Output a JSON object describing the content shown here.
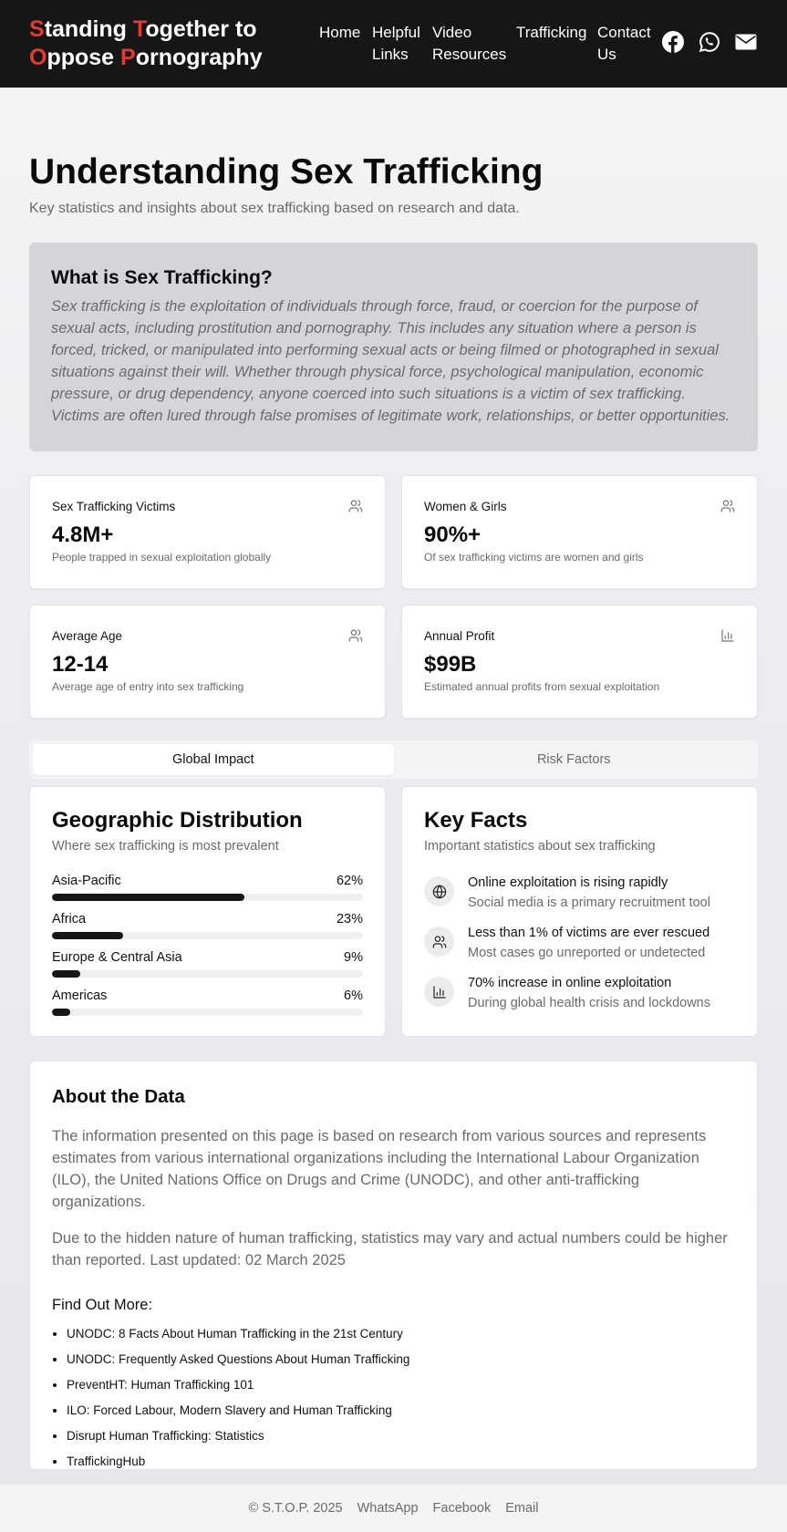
{
  "header": {
    "logo": {
      "line1": [
        {
          "cap": "S",
          "rest": "tanding "
        },
        {
          "cap": "T",
          "rest": "ogether to"
        }
      ],
      "line2": [
        {
          "cap": "O",
          "rest": "ppose "
        },
        {
          "cap": "P",
          "rest": "ornography"
        }
      ]
    },
    "nav": [
      {
        "line1": "Home",
        "line2": ""
      },
      {
        "line1": "Helpful",
        "line2": "Links"
      },
      {
        "line1": "Video",
        "line2": "Resources"
      },
      {
        "line1": "Trafficking",
        "line2": ""
      },
      {
        "line1": "Contact",
        "line2": "Us"
      }
    ],
    "social_icons": [
      "facebook-icon",
      "whatsapp-icon",
      "email-icon"
    ],
    "accent_color": "#e53935"
  },
  "page": {
    "title": "Understanding Sex Trafficking",
    "subtitle": "Key statistics and insights about sex trafficking based on research and data."
  },
  "definition": {
    "heading": "What is Sex Trafficking?",
    "body": "Sex trafficking is the exploitation of individuals through force, fraud, or coercion for the purpose of sexual acts, including prostitution and pornography. This includes any situation where a person is forced, tricked, or manipulated into performing sexual acts or being filmed or photographed in sexual situations against their will. Whether through physical force, psychological manipulation, economic pressure, or drug dependency, anyone coerced into such situations is a victim of sex trafficking. Victims are often lured through false promises of legitimate work, relationships, or better opportunities."
  },
  "stats": [
    {
      "label": "Sex Trafficking Victims",
      "value": "4.8M+",
      "desc": "People trapped in sexual exploitation globally",
      "icon": "users-icon"
    },
    {
      "label": "Women & Girls",
      "value": "90%+",
      "desc": "Of sex trafficking victims are women and girls",
      "icon": "users-icon"
    },
    {
      "label": "Average Age",
      "value": "12-14",
      "desc": "Average age of entry into sex trafficking",
      "icon": "users-icon"
    },
    {
      "label": "Annual Profit",
      "value": "$99B",
      "desc": "Estimated annual profits from sexual exploitation",
      "icon": "bar-chart-icon"
    }
  ],
  "tabs": [
    {
      "label": "Global Impact",
      "active": true
    },
    {
      "label": "Risk Factors",
      "active": false
    }
  ],
  "geo": {
    "title": "Geographic Distribution",
    "subtitle": "Where sex trafficking is most prevalent",
    "rows": [
      {
        "region": "Asia-Pacific",
        "pct_label": "62%",
        "pct": 62
      },
      {
        "region": "Africa",
        "pct_label": "23%",
        "pct": 23
      },
      {
        "region": "Europe & Central Asia",
        "pct_label": "9%",
        "pct": 9
      },
      {
        "region": "Americas",
        "pct_label": "6%",
        "pct": 6
      }
    ]
  },
  "facts": {
    "title": "Key Facts",
    "subtitle": "Important statistics about sex trafficking",
    "items": [
      {
        "title": "Online exploitation is rising rapidly",
        "sub": "Social media is a primary recruitment tool",
        "icon": "globe-icon"
      },
      {
        "title": "Less than 1% of victims are ever rescued",
        "sub": "Most cases go unreported or undetected",
        "icon": "users-icon"
      },
      {
        "title": "70% increase in online exploitation",
        "sub": "During global health crisis and lockdowns",
        "icon": "bar-chart-icon"
      }
    ]
  },
  "about": {
    "heading": "About the Data",
    "p1": "The information presented on this page is based on research from various sources and represents estimates from various international organizations including the International Labour Organization (ILO), the United Nations Office on Drugs and Crime (UNODC), and other anti-trafficking organizations.",
    "p2": "Due to the hidden nature of human trafficking, statistics may vary and actual numbers could be higher than reported. Last updated: 02 March 2025",
    "links_heading": "Find Out More:",
    "links": [
      "UNODC: 8 Facts About Human Trafficking in the 21st Century",
      "UNODC: Frequently Asked Questions About Human Trafficking",
      "PreventHT: Human Trafficking 101",
      "ILO: Forced Labour, Modern Slavery and Human Trafficking",
      "Disrupt Human Trafficking: Statistics",
      "TraffickingHub"
    ]
  },
  "footer": {
    "copyright": "© S.T.O.P. 2025",
    "links": [
      "WhatsApp",
      "Facebook",
      "Email"
    ]
  }
}
